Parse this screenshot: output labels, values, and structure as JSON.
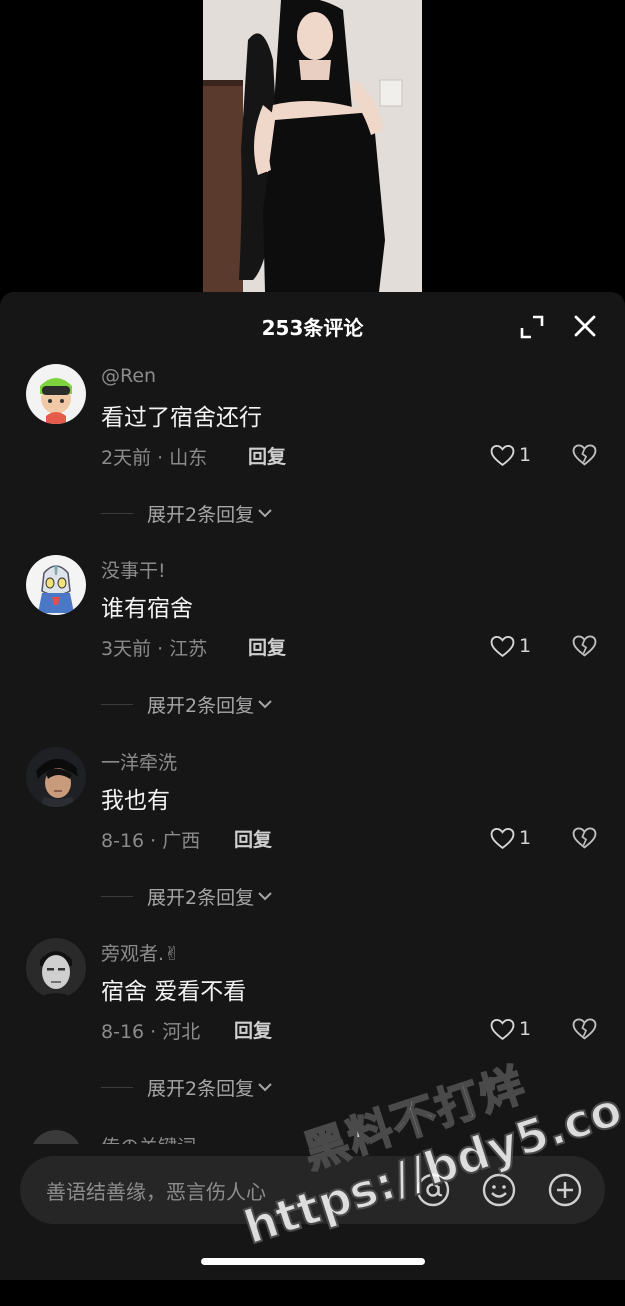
{
  "header": {
    "title": "253条评论"
  },
  "comments": [
    {
      "username": "@Ren",
      "text": "看过了宿舍还行",
      "meta": "2天前 · 山东",
      "reply_label": "回复",
      "likes": "1",
      "expand_label": "展开2条回复"
    },
    {
      "username": "没事干!",
      "text": "谁有宿舍",
      "meta": "3天前 · 江苏",
      "reply_label": "回复",
      "likes": "1",
      "expand_label": "展开2条回复"
    },
    {
      "username": "一洋牵洗",
      "text": "我也有",
      "meta": "8-16 · 广西",
      "reply_label": "回复",
      "likes": "1",
      "expand_label": "展开2条回复"
    },
    {
      "username": "旁观者.✌",
      "text": "宿舍 爱看不看",
      "meta": "8-16 · 河北",
      "reply_label": "回复",
      "likes": "1",
      "expand_label": "展开2条回复"
    }
  ],
  "peek_comment": {
    "username": "传の关键词"
  },
  "input": {
    "placeholder": "善语结善缘，恶言伤人心"
  },
  "watermark": {
    "line1": "黑料不打烊",
    "line2": "https://bdy5.co"
  },
  "colors": {
    "sheet_bg": "#161616",
    "input_bg": "#262626",
    "secondary_text": "#8b8b8b"
  }
}
